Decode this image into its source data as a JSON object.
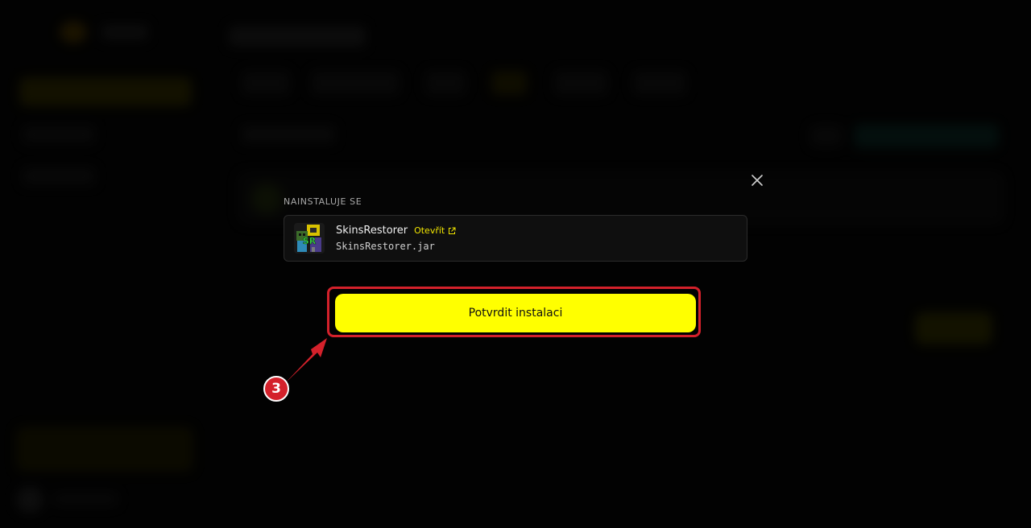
{
  "modal": {
    "section_label": "NAINSTALUJE SE",
    "close_icon": "close-icon",
    "plugin": {
      "name": "SkinsRestorer",
      "open_link_label": "Otevřít",
      "open_link_icon": "external-link-icon",
      "file_name": "SkinsRestorer.jar",
      "icon": "plugin-thumbnail-icon"
    },
    "confirm_button_label": "Potvrdit instalaci"
  },
  "annotation": {
    "step_number": "3",
    "color": "#d4212b"
  },
  "colors": {
    "accent": "#ffff00",
    "link": "#f2e600",
    "background": "#050505",
    "card_border": "#2b2b2b"
  }
}
